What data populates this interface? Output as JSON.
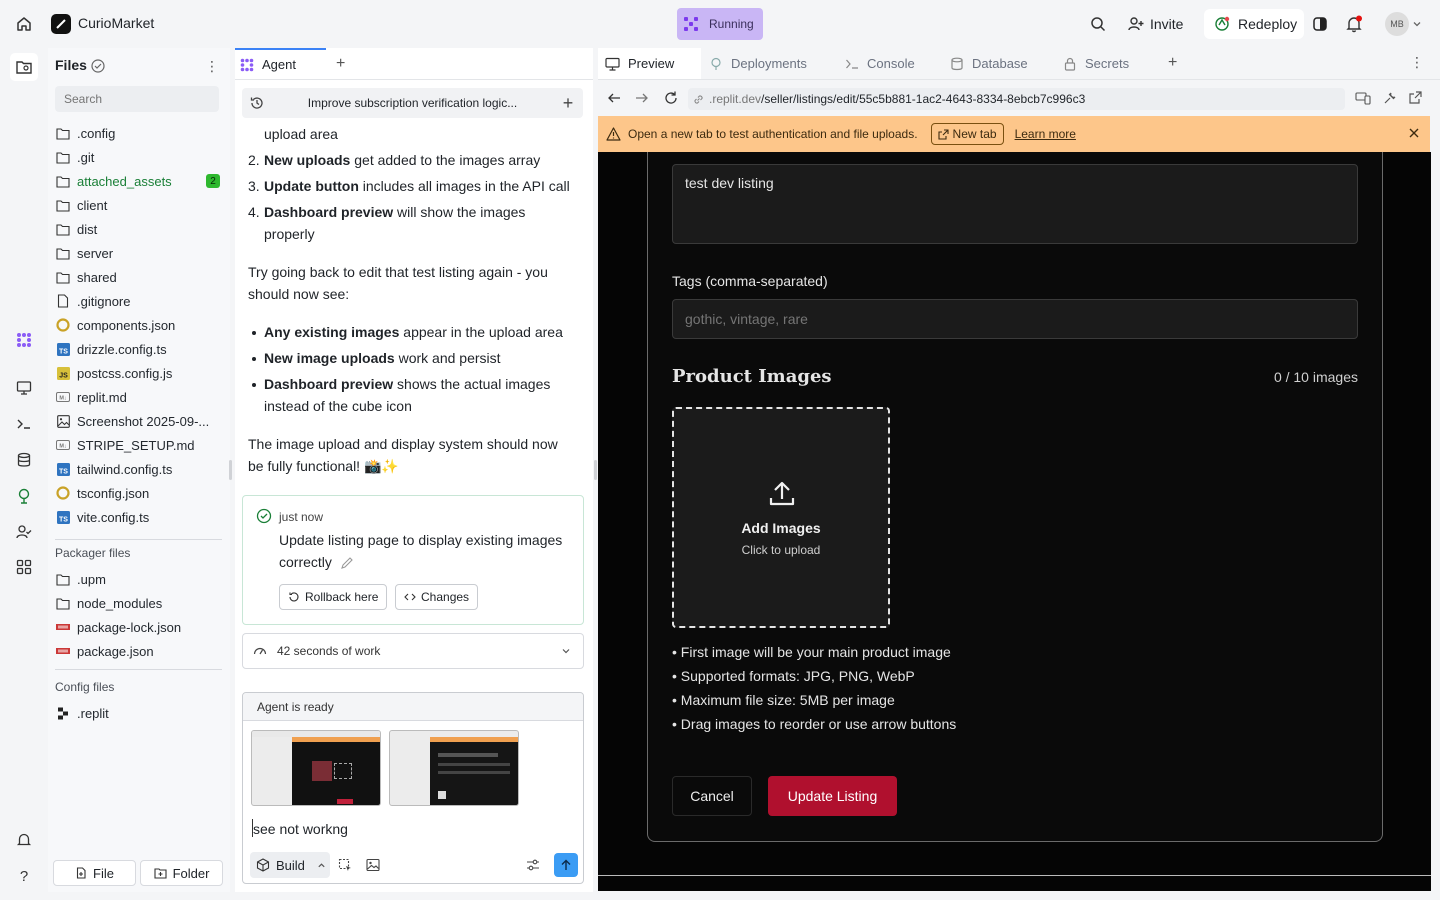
{
  "app": {
    "name": "CurioMarket",
    "status": "Running"
  },
  "header": {
    "invite_label": "Invite",
    "redeploy_label": "Redeploy",
    "avatar_initials": "MB"
  },
  "files": {
    "title": "Files",
    "search_placeholder": "Search",
    "items": [
      {
        "name": ".config",
        "type": "folder"
      },
      {
        "name": ".git",
        "type": "folder"
      },
      {
        "name": "attached_assets",
        "type": "folder",
        "badge": "2"
      },
      {
        "name": "client",
        "type": "folder"
      },
      {
        "name": "dist",
        "type": "folder"
      },
      {
        "name": "server",
        "type": "folder"
      },
      {
        "name": "shared",
        "type": "folder"
      },
      {
        "name": ".gitignore",
        "type": "file"
      },
      {
        "name": "components.json",
        "type": "json"
      },
      {
        "name": "drizzle.config.ts",
        "type": "ts"
      },
      {
        "name": "postcss.config.js",
        "type": "js"
      },
      {
        "name": "replit.md",
        "type": "md"
      },
      {
        "name": "Screenshot 2025-09-...",
        "type": "image"
      },
      {
        "name": "STRIPE_SETUP.md",
        "type": "md"
      },
      {
        "name": "tailwind.config.ts",
        "type": "ts"
      },
      {
        "name": "tsconfig.json",
        "type": "json"
      },
      {
        "name": "vite.config.ts",
        "type": "ts"
      }
    ],
    "packager_label": "Packager files",
    "packager_items": [
      {
        "name": ".upm",
        "type": "folder"
      },
      {
        "name": "node_modules",
        "type": "folder"
      },
      {
        "name": "package-lock.json",
        "type": "npm"
      },
      {
        "name": "package.json",
        "type": "npm"
      }
    ],
    "config_label": "Config files",
    "config_items": [
      {
        "name": ".replit",
        "type": "replit"
      }
    ],
    "file_button": "File",
    "folder_button": "Folder"
  },
  "agent": {
    "tab_label": "Agent",
    "thread_title": "Improve subscription verification logic...",
    "msg": {
      "line0": "upload area",
      "item2_bold": "New uploads",
      "item2_rest": " get added to the images array",
      "item3_bold": "Update button",
      "item3_rest": " includes all images in the API call",
      "item4_bold": "Dashboard preview",
      "item4_rest": " will show the images",
      "item4_cont": "properly",
      "para1_a": "Try going back to edit that test listing again - you",
      "para1_b": "should now see:",
      "b1_bold": "Any existing images",
      "b1_rest": " appear in the upload area",
      "b2_bold": "New image uploads",
      "b2_rest": " work and persist",
      "b3_bold": "Dashboard preview",
      "b3_rest": " shows the actual images",
      "b3_cont": "instead of the cube icon",
      "para2_a": "The image upload and display system should now",
      "para2_b": "be fully functional! 📸✨",
      "num2": "2.",
      "num3": "3.",
      "num4": "4."
    },
    "checkpoint": {
      "time": "just now",
      "title_a": "Update listing page to display existing images",
      "title_b": "correctly",
      "rollback_label": "Rollback here",
      "changes_label": "Changes"
    },
    "work": "42 seconds of work",
    "status": "Agent is ready",
    "input_text": "see not workng",
    "build_label": "Build"
  },
  "preview": {
    "tabs": [
      "Preview",
      "Deployments",
      "Console",
      "Database",
      "Secrets"
    ],
    "url_host": ".replit.dev",
    "url_path": "/seller/listings/edit/55c5b881-1ac2-4643-8334-8ebcb7c996c3",
    "notice": {
      "text": "Open a new tab to test authentication and file uploads.",
      "new_tab": "New tab",
      "learn_more": "Learn more"
    }
  },
  "form": {
    "description_value": "test dev listing",
    "tags_label": "Tags (comma-separated)",
    "tags_placeholder": "gothic, vintage, rare",
    "images_title": "Product Images",
    "images_count": "0 / 10 images",
    "add_images": "Add Images",
    "click_upload": "Click to upload",
    "bullets": [
      "• First image will be your main product image",
      "• Supported formats: JPG, PNG, WebP",
      "• Maximum file size: 5MB per image",
      "• Drag images to reorder or use arrow buttons"
    ],
    "cancel": "Cancel",
    "submit": "Update Listing"
  }
}
